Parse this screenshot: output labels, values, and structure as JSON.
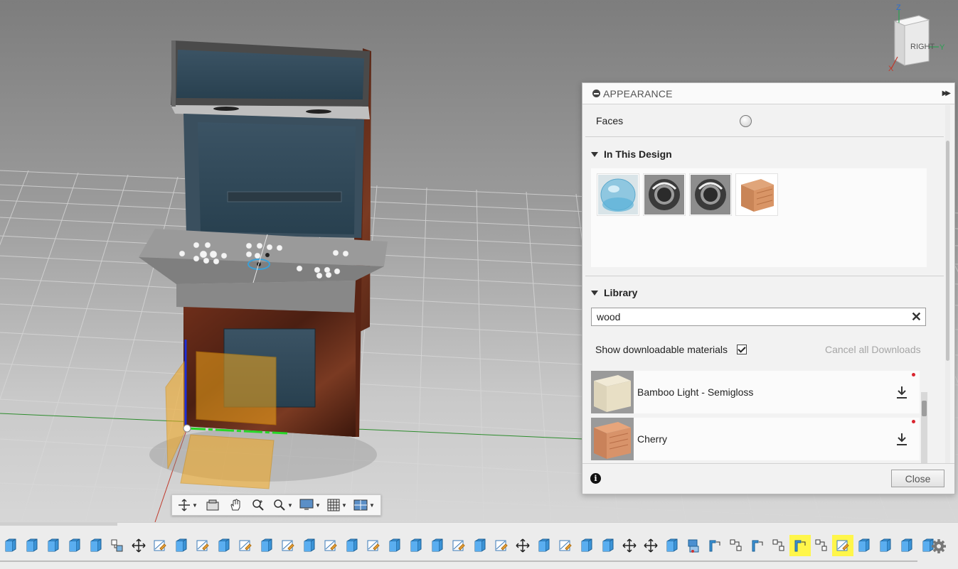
{
  "appearance_panel": {
    "title": "APPEARANCE",
    "faces_label": "Faces",
    "in_this_design": {
      "heading": "In This Design",
      "materials": [
        {
          "icon": "glass-material-swatch"
        },
        {
          "icon": "chrome-material-swatch"
        },
        {
          "icon": "chrome-material-swatch"
        },
        {
          "icon": "wood-material-swatch"
        }
      ]
    },
    "library": {
      "heading": "Library",
      "search_value": "wood",
      "show_downloadable_label": "Show downloadable materials",
      "show_downloadable_checked": true,
      "cancel_downloads_label": "Cancel all Downloads",
      "items": [
        {
          "name": "Bamboo Light - Semigloss",
          "icon": "bamboo-swatch"
        },
        {
          "name": "Cherry",
          "icon": "cherry-swatch"
        }
      ]
    },
    "close_label": "Close"
  },
  "viewcube": {
    "face_label": "RIGHT",
    "axis_z": "Z",
    "axis_y": "Y",
    "axis_x": "X"
  },
  "nav_toolbar": {
    "tools": [
      "orbit-icon",
      "look-at-icon",
      "pan-icon",
      "zoom-window-icon",
      "fit-icon",
      "display-settings-icon",
      "grid-icon",
      "viewports-icon"
    ]
  },
  "timeline": {
    "icons": [
      "body",
      "body",
      "body",
      "body",
      "body",
      "component",
      "move",
      "sketch",
      "body",
      "sketch",
      "body",
      "sketch",
      "body",
      "sketch",
      "body",
      "sketch",
      "body",
      "sketch",
      "body",
      "body",
      "body",
      "sketch",
      "body",
      "sketch",
      "move",
      "body",
      "sketch",
      "body",
      "body",
      "move",
      "move",
      "body",
      "joint",
      "rigid-group",
      "align",
      "rigid-group",
      "align",
      "rigid-group",
      "align",
      "sketch",
      "body",
      "body",
      "body",
      "body"
    ],
    "highlighted": [
      37,
      39
    ]
  },
  "colors": {
    "accent_selection": "#fff64a",
    "panel_bg": "#f2f2f2",
    "download_dot": "#d9252f"
  }
}
